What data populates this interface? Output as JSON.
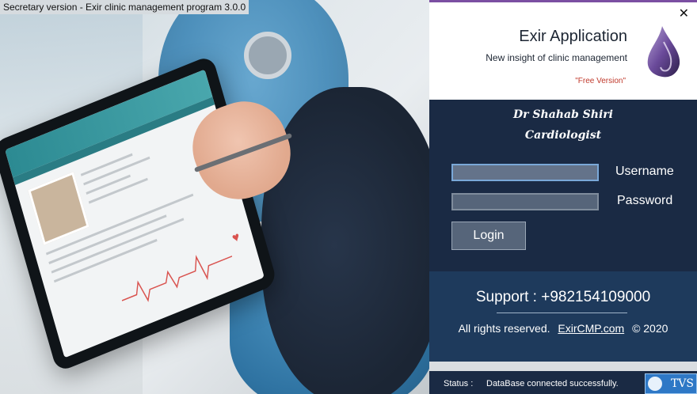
{
  "window": {
    "title": "Secretary version - Exir clinic management program 3.0.0"
  },
  "header": {
    "app_title": "Exir Application",
    "subtitle": "New insight of clinic management",
    "edition": "\"Free Version\"",
    "close_symbol": "✕"
  },
  "doctor": {
    "name": "Dr Shahab Shiri",
    "specialty": "Cardiologist"
  },
  "login_form": {
    "username_label": "Username",
    "username_value": "",
    "password_label": "Password",
    "password_value": "",
    "login_button": "Login"
  },
  "support": {
    "line": "Support : +982154109000",
    "rights": "All rights reserved.",
    "website": "ExirCMP.com",
    "copyright": "© 2020"
  },
  "status": {
    "label": "Status :",
    "value": "DataBase connected successfully.",
    "vendor_badge": "TVS"
  },
  "colors": {
    "panel_bg": "#1a2a44",
    "accent": "#7b4fa2",
    "free_version": "#c0392b",
    "support_bg": "#1e3a5c"
  },
  "icons": {
    "app_logo": "purple-drop-logo",
    "close": "close-icon"
  }
}
